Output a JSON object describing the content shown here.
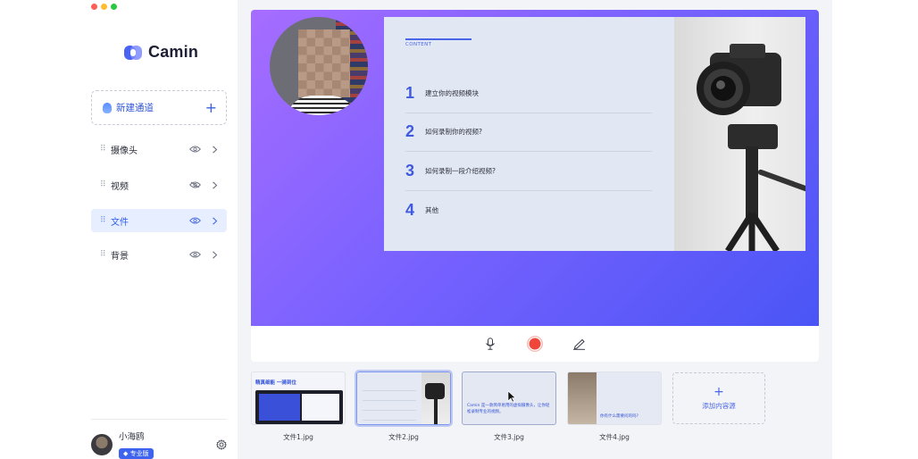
{
  "app": {
    "brand": "Camin"
  },
  "sidebar": {
    "new_channel_label": "新建通道",
    "items": [
      {
        "label": "摄像头",
        "active": false
      },
      {
        "label": "视频",
        "active": false
      },
      {
        "label": "文件",
        "active": true
      },
      {
        "label": "背景",
        "active": false
      }
    ],
    "user": {
      "name": "小海鸥",
      "plan": "专业版"
    }
  },
  "slide": {
    "kicker": "CONTENT",
    "items": [
      {
        "num": "1",
        "text": "建立你的视频模块"
      },
      {
        "num": "2",
        "text": "如何录制你的视频?"
      },
      {
        "num": "3",
        "text": "如何录制一段介绍视频?"
      },
      {
        "num": "4",
        "text": "其他"
      }
    ]
  },
  "thumbnails": [
    {
      "caption": "文件1.jpg",
      "title": "精真细能 一骑到位"
    },
    {
      "caption": "文件2.jpg"
    },
    {
      "caption": "文件3.jpg",
      "body": "Camin 是一款简单易用的虚拟摄像头，让你轻松录制专业的视频。"
    },
    {
      "caption": "文件4.jpg",
      "body": "你有什么需要问的吗?"
    }
  ],
  "add_content_label": "添加内容源",
  "colors": {
    "accent": "#3d63ef",
    "record": "#f0453a",
    "stage_start": "#a66cff",
    "stage_end": "#4a55f5"
  }
}
